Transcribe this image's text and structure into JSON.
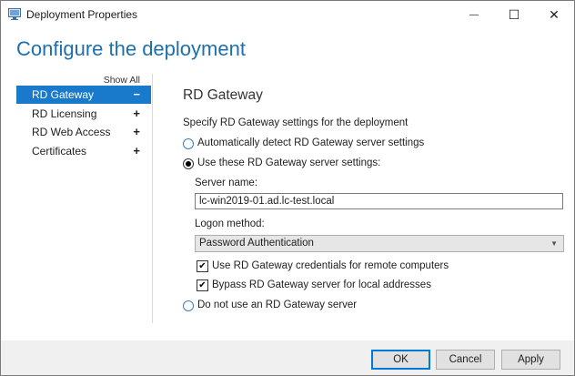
{
  "window": {
    "title": "Deployment Properties",
    "controls": {
      "minimize": "—",
      "maximize": "☐",
      "close": "✕"
    }
  },
  "heading": "Configure the deployment",
  "nav": {
    "show_all": "Show All",
    "items": [
      {
        "label": "RD Gateway",
        "symbol": "−",
        "selected": true
      },
      {
        "label": "RD Licensing",
        "symbol": "+",
        "selected": false
      },
      {
        "label": "RD Web Access",
        "symbol": "+",
        "selected": false
      },
      {
        "label": "Certificates",
        "symbol": "+",
        "selected": false
      }
    ]
  },
  "section": {
    "title": "RD Gateway",
    "description": "Specify RD Gateway settings for the deployment",
    "options": [
      {
        "label": "Automatically detect RD Gateway server settings",
        "selected": false
      },
      {
        "label": "Use these RD Gateway server settings:",
        "selected": true
      },
      {
        "label": "Do not use an RD Gateway server",
        "selected": false
      }
    ],
    "server_name_label": "Server name:",
    "server_name_value": "lc-win2019-01.ad.lc-test.local",
    "logon_label": "Logon method:",
    "logon_value": "Password Authentication",
    "checkboxes": [
      {
        "label": "Use RD Gateway credentials for remote computers",
        "checked": true
      },
      {
        "label": "Bypass RD Gateway server for local addresses",
        "checked": true
      }
    ]
  },
  "buttons": {
    "ok": "OK",
    "cancel": "Cancel",
    "apply": "Apply"
  },
  "colors": {
    "heading": "#1e6fae",
    "selection": "#1979ca"
  },
  "icons": {
    "app": "server-manager-icon",
    "dropdown": "chevron-down-icon",
    "check": "check-icon"
  }
}
